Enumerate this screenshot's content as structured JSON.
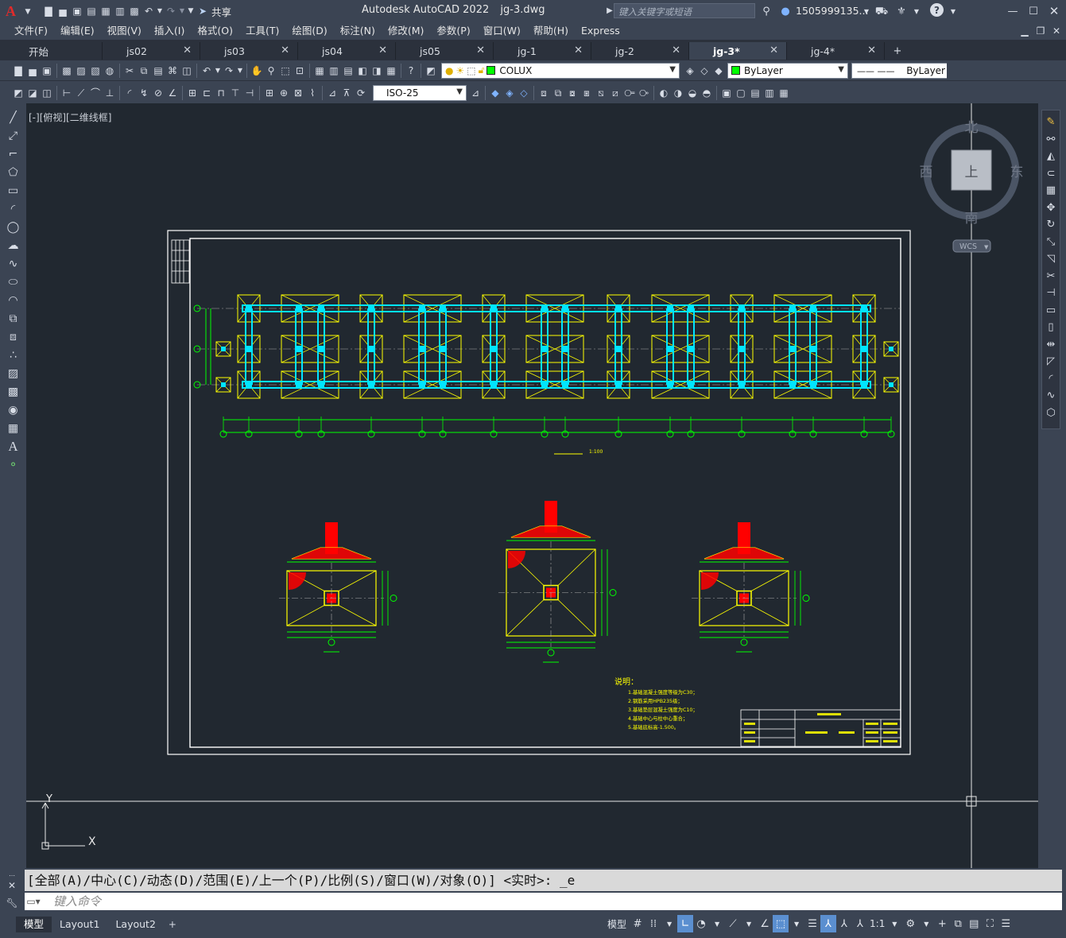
{
  "title_bar": {
    "app_title": "Autodesk AutoCAD 2022",
    "file_name": "jg-3.dwg",
    "share_label": "共享",
    "search_placeholder": "键入关键字或短语",
    "user_name": "1505999135...",
    "icons": [
      "app-logo-icon",
      "new-icon",
      "open-icon",
      "save-icon",
      "save-as-icon",
      "open-from-web-icon",
      "save-to-web-icon",
      "plot-icon",
      "undo-icon",
      "redo-icon",
      "share-icon",
      "search-icon",
      "user-icon",
      "cart-icon",
      "autodesk-icon",
      "help-icon",
      "minimize-icon",
      "maximize-icon",
      "close-icon"
    ]
  },
  "menu": [
    "文件(F)",
    "编辑(E)",
    "视图(V)",
    "插入(I)",
    "格式(O)",
    "工具(T)",
    "绘图(D)",
    "标注(N)",
    "修改(M)",
    "参数(P)",
    "窗口(W)",
    "帮助(H)",
    "Express"
  ],
  "doc_tabs": [
    {
      "label": "开始",
      "active": false,
      "closable": false
    },
    {
      "label": "js02",
      "active": false,
      "closable": true
    },
    {
      "label": "js03",
      "active": false,
      "closable": true
    },
    {
      "label": "js04",
      "active": false,
      "closable": true
    },
    {
      "label": "js05",
      "active": false,
      "closable": true
    },
    {
      "label": "jg-1",
      "active": false,
      "closable": true
    },
    {
      "label": "jg-2",
      "active": false,
      "closable": true
    },
    {
      "label": "jg-3*",
      "active": true,
      "closable": true
    },
    {
      "label": "jg-4*",
      "active": false,
      "closable": true
    }
  ],
  "toolbar": {
    "layer_name": "COLUX",
    "layer_color": "#00ff00",
    "color_control": "ByLayer",
    "linetype_control": "ByLayer",
    "dim_style": "ISO-25"
  },
  "viewport_label": "[-][俯视][二维线框]",
  "viewcube": {
    "north": "北",
    "south": "南",
    "east": "东",
    "west": "西",
    "top": "上",
    "wcs": "WCS"
  },
  "ucs": {
    "x": "X",
    "y": "Y"
  },
  "drawing": {
    "notes_heading": "说明：",
    "notes": [
      "1.基础混凝土强度等级为C30；",
      "2.钢筋采用HPB235级；",
      "3.基础垫层混凝土强度为C10；",
      "4.基础中心与柱中心重合；",
      "5.基础底标高-1.500。"
    ],
    "plan_scale": "1:100"
  },
  "command_line": {
    "history": "[全部(A)/中心(C)/动态(D)/范围(E)/上一个(P)/比例(S)/窗口(W)/对象(O)] <实时>: _e",
    "input_placeholder": "键入命令"
  },
  "layout_tabs": [
    "模型",
    "Layout1",
    "Layout2"
  ],
  "status_bar": {
    "model": "模型",
    "scale": "1:1"
  },
  "colors": {
    "ui_bg": "#3b4453",
    "canvas_bg": "#212830",
    "column": "#00e5ff",
    "footing": "#ffff00",
    "dimension": "#00ff00",
    "section_fill": "#ff0000"
  }
}
